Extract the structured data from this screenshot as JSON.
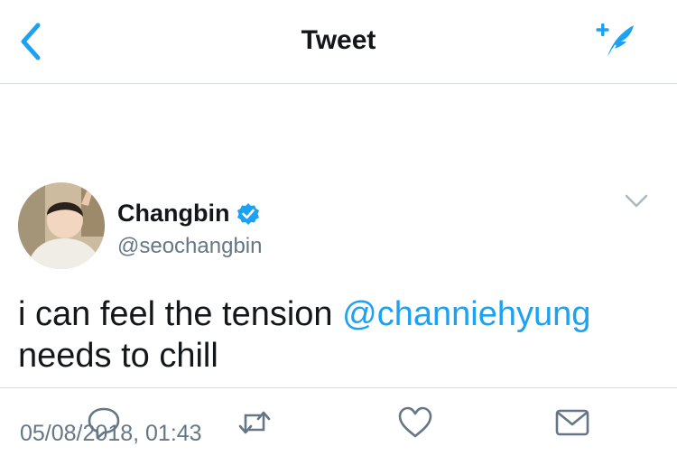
{
  "nav": {
    "title": "Tweet",
    "back_icon": "chevron-left-icon",
    "compose_icon": "compose-tweet-icon"
  },
  "author": {
    "name": "Changbin",
    "handle": "@seochangbin",
    "verified": true
  },
  "tweet": {
    "text_before": "i can feel the tension ",
    "mention": "@channiehyung",
    "text_after": " needs to chill",
    "timestamp": "05/08/2018, 01:43"
  },
  "actions": [
    "reply-icon",
    "retweet-icon",
    "like-icon",
    "direct-message-icon"
  ],
  "colors": {
    "accent": "#1da1f2",
    "secondary_text": "#657786",
    "primary_text": "#14171a",
    "divider": "#d5dbe0"
  }
}
